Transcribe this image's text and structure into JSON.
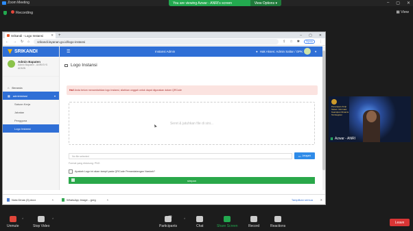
{
  "zoom": {
    "window_title": "Zoom Meeting",
    "banner_text": "You are viewing Azwar - ANRI's screen",
    "view_options": "View Options",
    "recording": "Recording",
    "view": "View",
    "toolbar": {
      "unmute": "Unmute",
      "stop_video": "Stop Video",
      "participants": "Participants",
      "participants_count": "49",
      "chat": "Chat",
      "share_screen": "Share Screen",
      "record": "Record",
      "reactions": "Reactions",
      "leave": "Leave"
    },
    "video_name": "Azwar - ANRI",
    "video_overlay": "Penerapan Arsip Sistem Informasi Kearsipan Dinamis Terintegrasi"
  },
  "browser": {
    "tab_title": "Srikandi - Logo Instansi",
    "url": "srikandi.layanan.go.id/logo-instansi",
    "profile": "Dijeda",
    "downloads": [
      {
        "name": "Nota Dinas (3).docx"
      },
      {
        "name": "WhatsApp Image....jpeg"
      }
    ],
    "show_all": "Tampilkan semua"
  },
  "app": {
    "brand": "SRIKANDI",
    "user": {
      "name": "Admin Bapaten",
      "role": "Admin Bapaten - ANRI/SYS ADMIN"
    },
    "nav": [
      {
        "label": "Beranda"
      },
      {
        "label": "administrasi"
      }
    ],
    "subnav": [
      "Satuan Kerja",
      "Jabatan",
      "Pengguna",
      "Logo Instansi"
    ],
    "topbar_center": "Instansi Admin",
    "topbar_user": "Hak Akses: Admin Saltar / OPK",
    "page_title": "Logo Instansi",
    "alert_strong": "Hai!",
    "alert_text": "Anda belum menambahkan logo Instansi, silahkan unggah untuk dapat digunakan dalam QRCode",
    "dropzone": "Seret & jatuhkan file di sini...",
    "file_placeholder": "No file selected",
    "browse": "Jelajahi",
    "format_note": "Format yang didukung: PNG",
    "checkbox_label": "Apakah Logo ini akan tampil pada QRCode Penandatangan Naskah?",
    "save": "simpan"
  }
}
